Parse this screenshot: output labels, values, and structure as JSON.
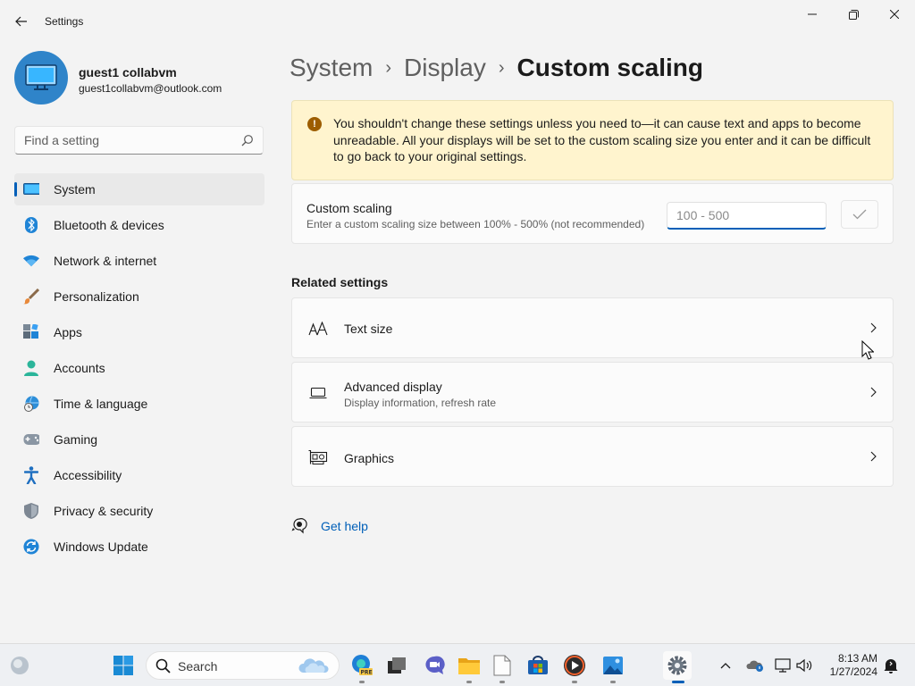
{
  "window": {
    "title": "Settings",
    "back_icon": "back-arrow-icon",
    "controls": [
      "minimize-icon",
      "maximize-icon",
      "close-icon"
    ]
  },
  "profile": {
    "name": "guest1 collabvm",
    "email": "guest1collabvm@outlook.com",
    "avatar_icon": "monitor-avatar-icon"
  },
  "search": {
    "placeholder": "Find a setting",
    "icon": "search-icon"
  },
  "nav": {
    "items": [
      {
        "label": "System",
        "icon": "system-icon",
        "active": true
      },
      {
        "label": "Bluetooth & devices",
        "icon": "bluetooth-icon"
      },
      {
        "label": "Network & internet",
        "icon": "wifi-icon"
      },
      {
        "label": "Personalization",
        "icon": "brush-icon"
      },
      {
        "label": "Apps",
        "icon": "apps-icon"
      },
      {
        "label": "Accounts",
        "icon": "accounts-icon"
      },
      {
        "label": "Time & language",
        "icon": "time-language-icon"
      },
      {
        "label": "Gaming",
        "icon": "gamepad-icon"
      },
      {
        "label": "Accessibility",
        "icon": "accessibility-icon"
      },
      {
        "label": "Privacy & security",
        "icon": "shield-icon"
      },
      {
        "label": "Windows Update",
        "icon": "update-icon"
      }
    ]
  },
  "breadcrumb": {
    "items": [
      "System",
      "Display"
    ],
    "separator": "›",
    "current": "Custom scaling"
  },
  "warning": {
    "icon": "warning-icon",
    "text": "You shouldn't change these settings unless you need to—it can cause text and apps to become unreadable. All your displays will be set to the custom scaling size you enter and it can be difficult to go back to your original settings."
  },
  "custom_scaling": {
    "title": "Custom scaling",
    "description": "Enter a custom scaling size between 100% - 500% (not recommended)",
    "input_value": "",
    "input_placeholder": "100 - 500",
    "apply_icon": "checkmark-icon"
  },
  "related": {
    "heading": "Related settings",
    "items": [
      {
        "title": "Text size",
        "subtitle": "",
        "icon": "text-size-icon"
      },
      {
        "title": "Advanced display",
        "subtitle": "Display information, refresh rate",
        "icon": "laptop-display-icon"
      },
      {
        "title": "Graphics",
        "subtitle": "",
        "icon": "graphics-card-icon"
      }
    ]
  },
  "help": {
    "label": "Get help",
    "icon": "help-chat-icon"
  },
  "taskbar": {
    "search_label": "Search",
    "apps": [
      "start-icon",
      "copilot-edge-pre-icon",
      "task-view-icon",
      "teams-chat-icon",
      "file-explorer-icon",
      "notepad-icon",
      "store-icon",
      "media-player-icon",
      "photos-icon",
      "settings-icon"
    ],
    "tray": [
      "chevron-up-icon",
      "onedrive-icon",
      "network-icon",
      "volume-icon",
      "notification-icon"
    ],
    "time": "8:13 AM",
    "date": "1/27/2024"
  },
  "colors": {
    "accent": "#005fb8",
    "warning_bg": "#fff4ce",
    "warning_icon": "#9d5d00",
    "window_bg": "#f3f3f3",
    "card_bg": "#fbfbfb"
  }
}
